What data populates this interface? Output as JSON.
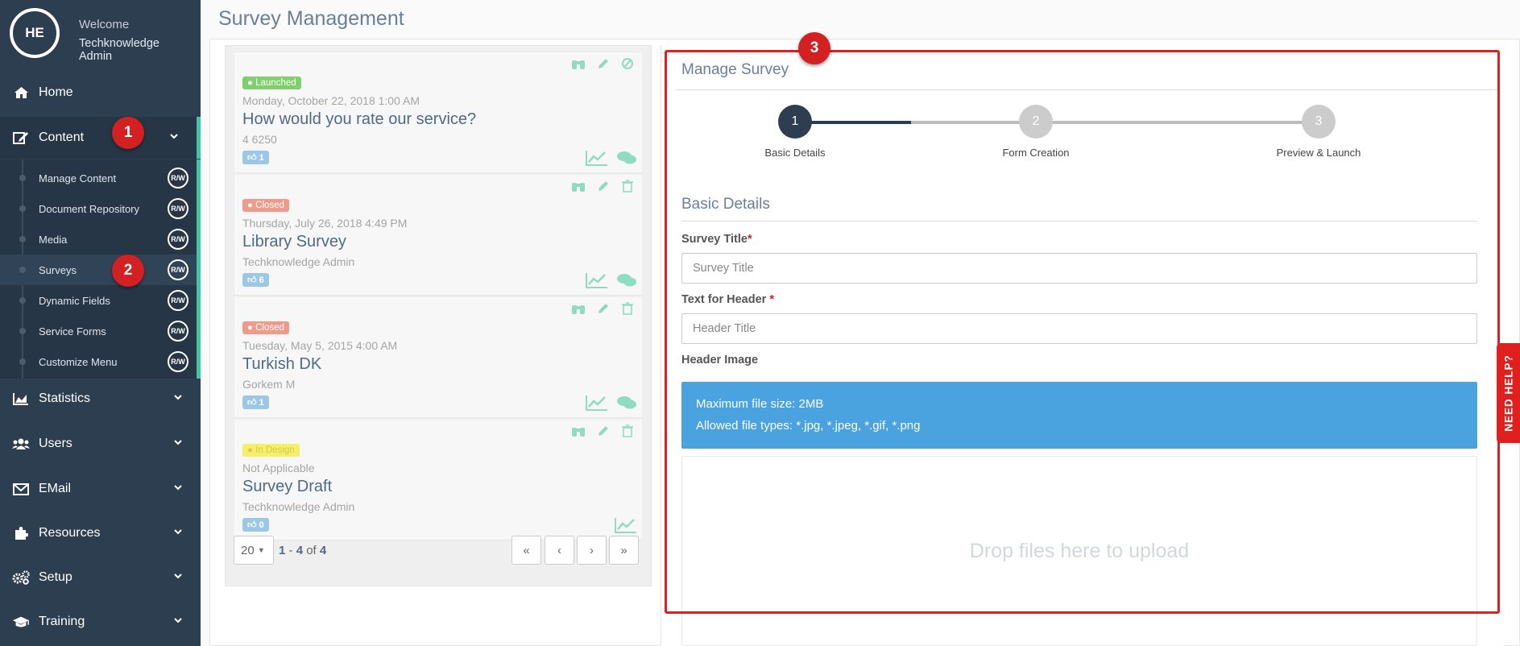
{
  "sidebar": {
    "avatar_initials": "HE",
    "welcome": "Welcome",
    "user_name": "Techknowledge Admin",
    "items": [
      {
        "label": "Home",
        "icon": "home-icon"
      },
      {
        "label": "Content",
        "icon": "edit-icon"
      },
      {
        "label": "Statistics",
        "icon": "area-chart-icon"
      },
      {
        "label": "Users",
        "icon": "users-icon"
      },
      {
        "label": "EMail",
        "icon": "envelope-icon"
      },
      {
        "label": "Resources",
        "icon": "puzzle-icon"
      },
      {
        "label": "Setup",
        "icon": "cogs-icon"
      },
      {
        "label": "Training",
        "icon": "graduation-cap-icon"
      }
    ],
    "content_sub": [
      {
        "label": "Manage Content",
        "badge": "R/W"
      },
      {
        "label": "Document Repository",
        "badge": "R/W"
      },
      {
        "label": "Media",
        "badge": "R/W"
      },
      {
        "label": "Surveys",
        "badge": "R/W"
      },
      {
        "label": "Dynamic Fields",
        "badge": "R/W"
      },
      {
        "label": "Service Forms",
        "badge": "R/W"
      },
      {
        "label": "Customize Menu",
        "badge": "R/W"
      }
    ]
  },
  "markers": [
    "1",
    "2",
    "3"
  ],
  "page_title": "Survey Management",
  "surveys": [
    {
      "status": "Launched",
      "status_color": "#7ed06b",
      "date": "Monday, October 22, 2018 1:00 AM",
      "title": "How would you rate our service?",
      "meta": "4 6250",
      "likes": "1"
    },
    {
      "status": "Closed",
      "status_color": "#ef9a8a",
      "date": "Thursday, July 26, 2018 4:49 PM",
      "title": "Library Survey",
      "meta": "Techknowledge Admin",
      "likes": "6"
    },
    {
      "status": "Closed",
      "status_color": "#ef9a8a",
      "date": "Tuesday, May 5, 2015 4:00 AM",
      "title": "Turkish DK",
      "meta": "Gorkem M",
      "likes": "1"
    },
    {
      "status": "In Design",
      "status_color": "#f5ef6a",
      "date": "Not Applicable",
      "title": "Survey Draft",
      "meta": "Techknowledge Admin",
      "likes": "0"
    }
  ],
  "pager": {
    "page_size": "20",
    "range_start": "1",
    "range_end": "4",
    "of": "of",
    "total": "4",
    "first": "«",
    "prev": "‹",
    "next": "›",
    "last": "»"
  },
  "manage": {
    "title": "Manage Survey",
    "steps": [
      {
        "num": "1",
        "label": "Basic Details"
      },
      {
        "num": "2",
        "label": "Form Creation"
      },
      {
        "num": "3",
        "label": "Preview & Launch"
      }
    ],
    "section": "Basic Details",
    "survey_title_label": "Survey Title",
    "survey_title_placeholder": "Survey Title",
    "header_label": "Text for Header ",
    "header_placeholder": "Header Title",
    "image_label": "Header Image",
    "required_mark": "*",
    "info_line1": "Maximum file size: 2MB",
    "info_line2": "Allowed file types: *.jpg, *.jpeg, *.gif, *.png",
    "dropzone": "Drop files here to upload"
  },
  "need_help": "NEED HELP?",
  "colors": {
    "sidebar": "#2d3e50",
    "accent": "#3ec7a0",
    "marker": "#d32020",
    "info": "#4aa3df"
  }
}
